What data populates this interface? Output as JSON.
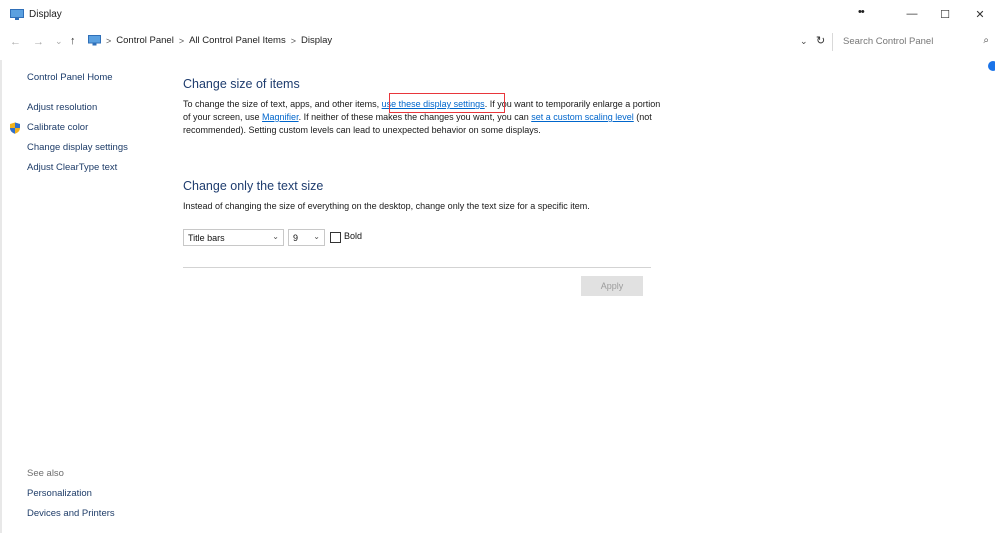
{
  "window": {
    "title": "Display",
    "caption": {
      "more": "••",
      "minimize": "—",
      "maximize": "☐",
      "close": "✕"
    }
  },
  "address": {
    "back": "←",
    "forward": "→",
    "recent": "⌄",
    "up": "↑",
    "breadcrumb": [
      "Control Panel",
      "All Control Panel Items",
      "Display"
    ],
    "separator": ">",
    "dropdown": "⌄",
    "refresh": "↻",
    "search_placeholder": "Search Control Panel",
    "search_icon": "⌕"
  },
  "sidebar": {
    "home": "Control Panel Home",
    "items": [
      "Adjust resolution",
      "Calibrate color",
      "Change display settings",
      "Adjust ClearType text"
    ],
    "see_also_label": "See also",
    "see_also": [
      "Personalization",
      "Devices and Printers"
    ]
  },
  "main": {
    "section1": {
      "heading": "Change size of items",
      "text1": "To change the size of text, apps, and other items, ",
      "link1": "use these display settings",
      "text2": ". If you want to temporarily enlarge a portion of your screen, use ",
      "link2": "Magnifier",
      "text3": ". If neither of these makes the changes you want, you can ",
      "link3": "set a custom scaling level",
      "text4": " (not recommended). Setting custom levels can lead to unexpected behavior on some displays."
    },
    "section2": {
      "heading": "Change only the text size",
      "description": "Instead of changing the size of everything on the desktop, change only the text size for a specific item.",
      "item_select": "Title bars",
      "size_select": "9",
      "chevron": "⌄",
      "bold_label": "Bold",
      "bold_checked": false,
      "apply": "Apply"
    }
  },
  "colors": {
    "link": "#0066cc",
    "heading": "#1e3c6e",
    "highlight": "#e8363b"
  }
}
